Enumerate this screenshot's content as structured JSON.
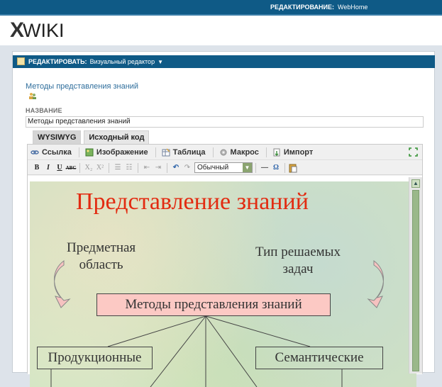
{
  "header": {
    "mode_label": "РЕДАКТИРОВАНИЕ:",
    "document": "WebHome"
  },
  "brand": {
    "logo_x": "X",
    "logo_text": "WIKI"
  },
  "editbar": {
    "label": "РЕДАКТИРОВАТЬ:",
    "editor": "Визуальный редактор",
    "arrow": "▼"
  },
  "page": {
    "breadcrumb": "Методы представления знаний",
    "title_label": "НАЗВАНИЕ",
    "title_value": "Методы представления знаний"
  },
  "tabs": [
    {
      "label": "WYSIWYG"
    },
    {
      "label": "Исходный код"
    }
  ],
  "toolbar1": {
    "link": "Ссылка",
    "image": "Изображение",
    "table": "Таблица",
    "macro": "Макрос",
    "import": "Импорт"
  },
  "toolbar2": {
    "bold": "B",
    "italic": "I",
    "underline": "U",
    "strike": "ABC",
    "subscript": "X₂",
    "superscript": "X²",
    "format_value": "Обычный"
  },
  "slide": {
    "title": "Представление знаний",
    "left_line1": "Предметная",
    "left_line2": "область",
    "right_line1": "Тип решаемых",
    "right_line2": "задач",
    "center": "Методы представления знаний",
    "left_box": "Продукционные",
    "right_box": "Семантические"
  },
  "colors": {
    "topbar": "#0f5a86",
    "slide_title": "#e22b11",
    "methods_box": "#fcc9c4"
  }
}
